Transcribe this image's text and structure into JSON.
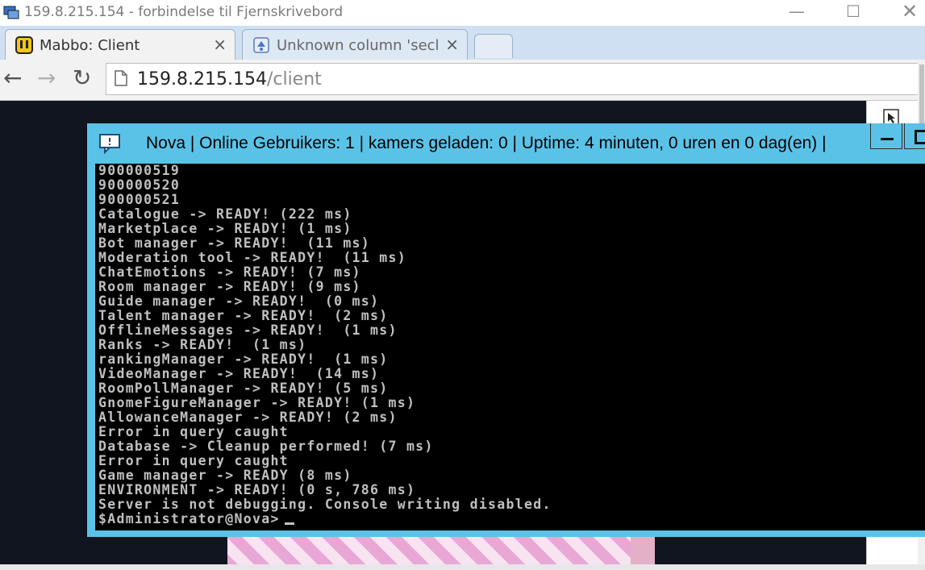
{
  "rdp_window": {
    "title": "159.8.215.154 - forbindelse til Fjernskrivebord",
    "icon": "remote-desktop-icon",
    "controls": {
      "minimize": "—",
      "maximize": "☐",
      "close": "✕"
    }
  },
  "browser": {
    "tabs": [
      {
        "title": "Mabbo: Client",
        "favicon": "mabbo-favicon",
        "close": "×",
        "active": true
      },
      {
        "title": "Unknown column 'seckey'",
        "favicon": "page-error-favicon",
        "close": "×",
        "active": false
      }
    ],
    "nav": {
      "back": "←",
      "forward": "→",
      "reload": "↻"
    },
    "url": {
      "host": "159.8.215.154",
      "path": "/client"
    }
  },
  "console": {
    "icon": "console-chat-icon",
    "title": "Nova | Online Gebruikers: 1 | kamers geladen: 0 | Uptime: 4 minuten, 0 uren en 0 dag(en) |",
    "lines": [
      "900000519",
      "900000520",
      "900000521",
      "Catalogue -> READY! (222 ms)",
      "Marketplace -> READY! (1 ms)",
      "Bot manager -> READY!  (11 ms)",
      "Moderation tool -> READY!  (11 ms)",
      "ChatEmotions -> READY! (7 ms)",
      "Room manager -> READY! (9 ms)",
      "Guide manager -> READY!  (0 ms)",
      "Talent manager -> READY!  (2 ms)",
      "OfflineMessages -> READY!  (1 ms)",
      "Ranks -> READY!  (1 ms)",
      "rankingManager -> READY!  (1 ms)",
      "VideoManager -> READY!  (14 ms)",
      "RoomPollManager -> READY! (5 ms)",
      "GnomeFigureManager -> READY! (1 ms)",
      "AllowanceManager -> READY! (2 ms)",
      "Error in query caught",
      "Database -> Cleanup performed! (7 ms)",
      "Error in query caught",
      "Game manager -> READY (8 ms)",
      "ENVIRONMENT -> READY! (0 s, 786 ms)",
      "Server is not debugging. Console writing disabled."
    ],
    "prompt": "$Administrator@Nova>"
  },
  "colors": {
    "console_frame": "#5bc2e7",
    "console_bg": "#000000",
    "console_text": "#c0c0c0",
    "tabstrip": "#cfe0f3"
  }
}
